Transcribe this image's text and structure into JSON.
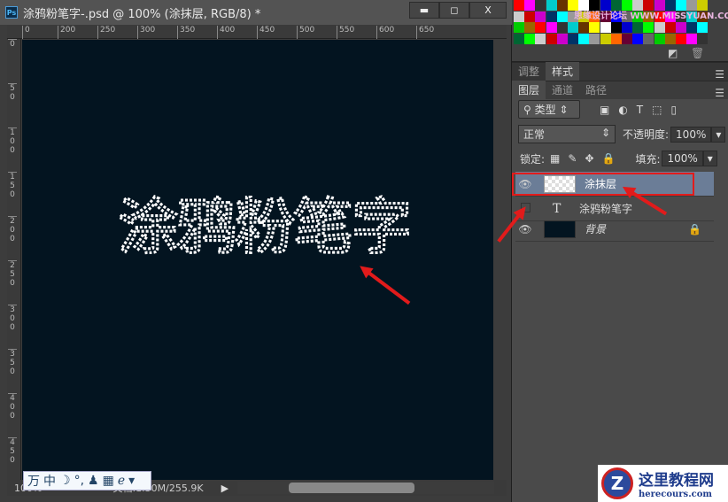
{
  "document": {
    "title": "涂鸦粉笔字-.psd @ 100% (涂抹层, RGB/8) *",
    "app_icon": "Ps",
    "window_buttons": {
      "minimize": "▬",
      "maximize": "◻",
      "close": "X"
    },
    "h_ruler": [
      "0",
      "200",
      "250",
      "300",
      "350",
      "400",
      "450",
      "500",
      "550",
      "600",
      "650"
    ],
    "v_ruler": [
      "0",
      "50",
      "100",
      "150",
      "200",
      "250",
      "300",
      "350",
      "400",
      "450"
    ],
    "canvas_text": "涂鸦粉笔字",
    "canvas_color": "#031420",
    "status": {
      "zoom": "100%",
      "doc_info": "文档:1.30M/255.9K"
    }
  },
  "ime_bar": {
    "items": [
      "万",
      "中",
      "☽",
      "°,",
      "♟",
      "▦",
      "ℯ",
      "▾"
    ]
  },
  "swatch_panel": {
    "watermark": "思缘设计论坛 WWW.MISSYUAN.COM"
  },
  "panel_tabs_top": [
    {
      "label": "调整"
    },
    {
      "label": "样式",
      "active": true
    }
  ],
  "layers_panel": {
    "tabs": [
      {
        "label": "图层",
        "active": true
      },
      {
        "label": "通道"
      },
      {
        "label": "路径"
      }
    ],
    "filter_kind": "类型",
    "blend_mode": "正常",
    "opacity_label": "不透明度:",
    "opacity": "100%",
    "lock_label": "锁定:",
    "fill_label": "填充:",
    "fill": "100%",
    "layers": [
      {
        "name": "涂抹层",
        "visible": true,
        "selected": true,
        "type": "pixel"
      },
      {
        "name": "涂鸦粉笔字",
        "visible": false,
        "selected": false,
        "type": "text"
      },
      {
        "name": "背景",
        "visible": true,
        "selected": false,
        "type": "background",
        "locked": true
      }
    ]
  },
  "logo": {
    "name": "这里教程网",
    "url_text": "herecours.com"
  },
  "accent_color": "#e21b1b"
}
